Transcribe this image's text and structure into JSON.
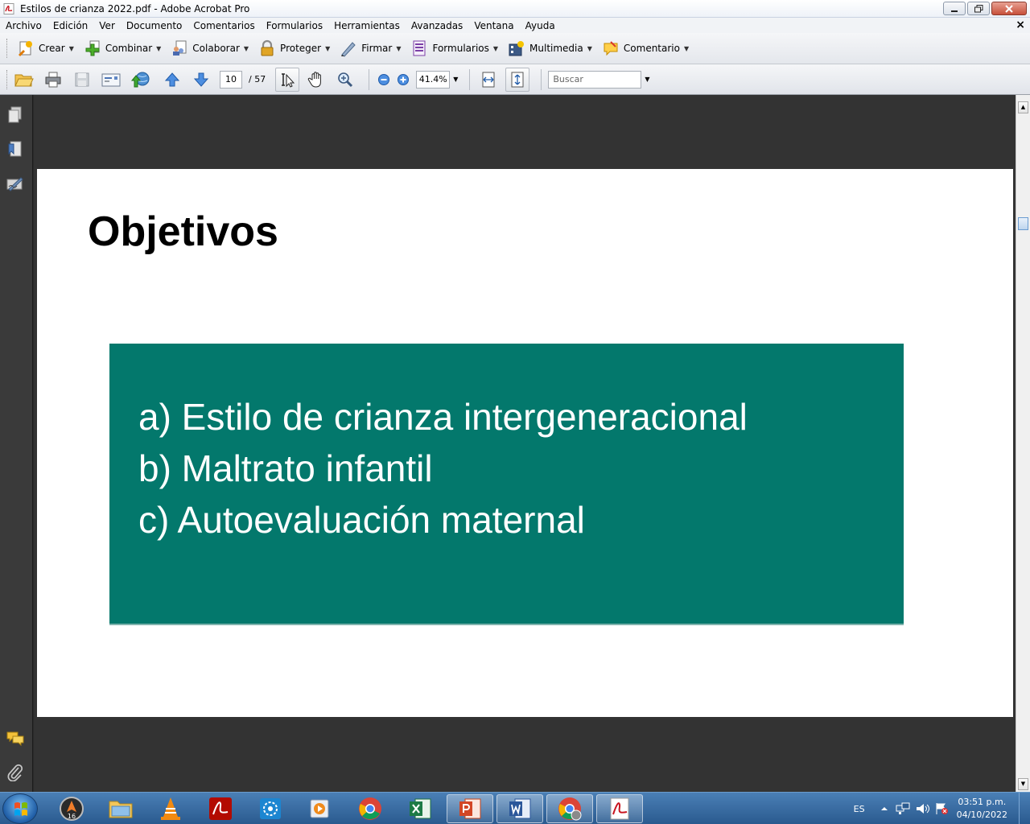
{
  "window": {
    "title": "Estilos de crianza 2022.pdf - Adobe Acrobat Pro"
  },
  "menu": {
    "items": [
      "Archivo",
      "Edición",
      "Ver",
      "Documento",
      "Comentarios",
      "Formularios",
      "Herramientas",
      "Avanzadas",
      "Ventana",
      "Ayuda"
    ],
    "close_glyph": "×"
  },
  "toolbar1": {
    "crear": "Crear",
    "combinar": "Combinar",
    "colaborar": "Colaborar",
    "proteger": "Proteger",
    "firmar": "Firmar",
    "formularios": "Formularios",
    "multimedia": "Multimedia",
    "comentario": "Comentario"
  },
  "toolbar2": {
    "page_current": "10",
    "page_total": "/ 57",
    "zoom": "41.4%",
    "search_placeholder": "Buscar"
  },
  "document": {
    "title": "Objetivos",
    "objectives": [
      "a) Estilo de crianza intergeneracional",
      "b) Maltrato infantil",
      "c) Autoevaluación maternal"
    ]
  },
  "taskbar": {
    "lang": "ES",
    "time": "03:51 p.m.",
    "date": "04/10/2022",
    "badge": "16"
  },
  "colors": {
    "green_box": "#03786c",
    "acrobat_red": "#b30b00"
  }
}
